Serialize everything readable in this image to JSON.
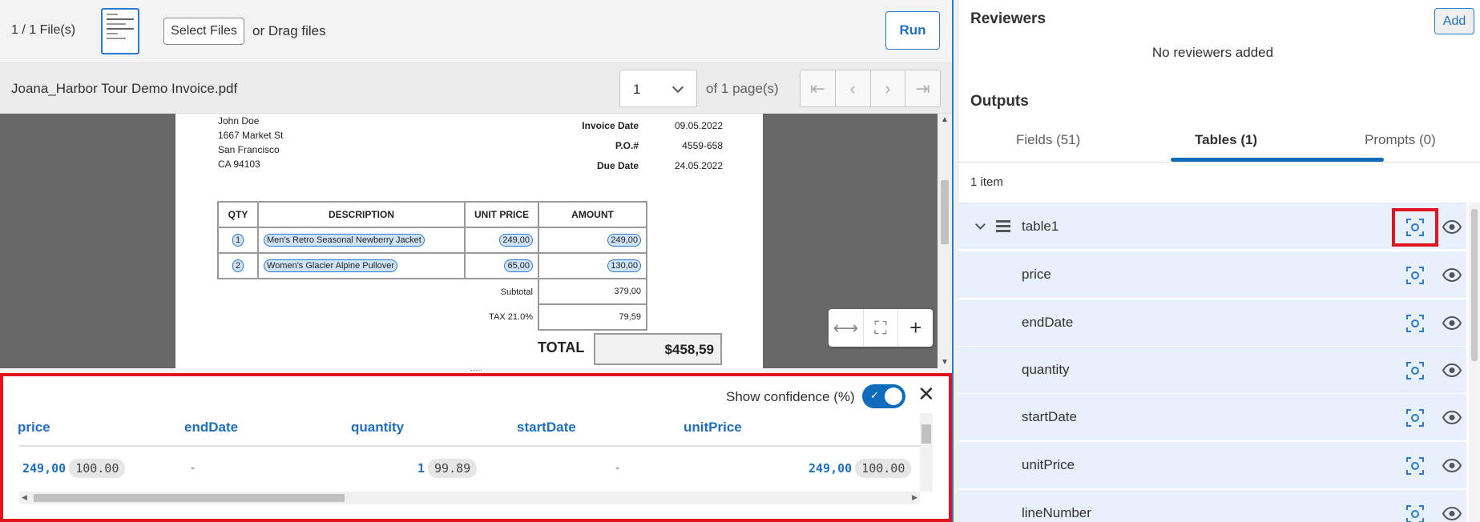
{
  "toolbar": {
    "file_count": "1 / 1 File(s)",
    "select_files": "Select Files",
    "drag_text": "or Drag files",
    "run": "Run"
  },
  "docbar": {
    "file_name": "Joana_Harbor Tour Demo Invoice.pdf",
    "page_value": "1",
    "of_pages": "of 1 page(s)",
    "pager_icons": [
      "first-page-icon",
      "previous-page-icon",
      "next-page-icon",
      "last-page-icon"
    ]
  },
  "invoice": {
    "address": [
      "John Doe",
      "1667 Market St",
      "San Francisco",
      "CA 94103"
    ],
    "meta_labels": [
      "Invoice Date",
      "P.O.#",
      "Due Date"
    ],
    "meta_values": [
      "09.05.2022",
      "4559-658",
      "24.05.2022"
    ],
    "headers": [
      "QTY",
      "DESCRIPTION",
      "UNIT PRICE",
      "AMOUNT"
    ],
    "rows": [
      {
        "qty": "1",
        "description": "Men's Retro Seasonal Newberry Jacket",
        "unit_price": "249,00",
        "amount": "249,00"
      },
      {
        "qty": "2",
        "description": "Women's Glacier Alpine Pullover",
        "unit_price": "65,00",
        "amount": "130,00"
      }
    ],
    "subtotal_label": "Subtotal",
    "subtotal_value": "379,00",
    "tax_label": "TAX 21.0%",
    "tax_value": "79,59",
    "total_label": "TOTAL",
    "total_value": "$458,59"
  },
  "results": {
    "show_confidence": "Show confidence (%)",
    "confidence_on": true,
    "columns": [
      "price",
      "endDate",
      "quantity",
      "startDate",
      "unitPrice"
    ],
    "row": {
      "price": "249,00",
      "price_conf": "100.00",
      "endDate": "-",
      "quantity": "1",
      "quantity_conf": "99.89",
      "startDate": "-",
      "unitPrice": "249,00",
      "unitPrice_conf": "100.00"
    }
  },
  "reviewers": {
    "title": "Reviewers",
    "add": "Add",
    "empty": "No reviewers added"
  },
  "outputs": {
    "title": "Outputs",
    "tabs": [
      "Fields (51)",
      "Tables (1)",
      "Prompts (0)"
    ],
    "active_tab": "Tables (1)",
    "count": "1 item",
    "table_name": "table1",
    "fields": [
      "price",
      "endDate",
      "quantity",
      "startDate",
      "unitPrice",
      "lineNumber"
    ]
  },
  "colors": {
    "accent": "#0f6cbd",
    "highlight_box": "#e0141e",
    "row_bg": "#e8f1fb"
  }
}
